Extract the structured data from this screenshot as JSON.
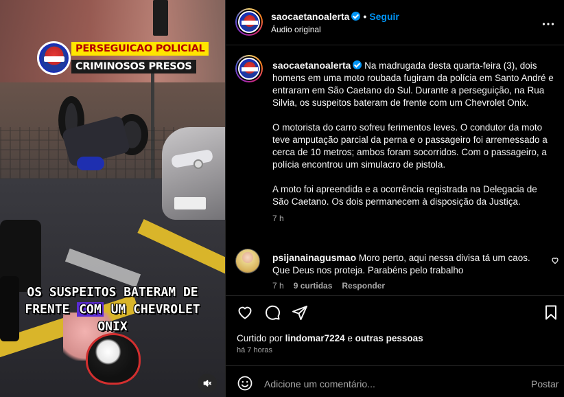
{
  "media": {
    "overlay_tag_1": "PERSEGUICAO POLICIAL",
    "overlay_tag_2": "CRIMINOSOS PRESOS",
    "caption_part1": "OS SUSPEITOS BATERAM DE",
    "caption_part2a": "FRENTE ",
    "caption_highlight": "COM",
    "caption_part2b": " UM CHEVROLET",
    "caption_part3": "ONIX",
    "logo_text": "SÃO CAETANO ALERTA",
    "mute_icon": "speaker-muted-icon",
    "colors": {
      "tag_yellow": "#ffe500",
      "tag_red_text": "#b30000",
      "highlight": "#5b2bd6"
    }
  },
  "header": {
    "username": "saocaetanoalerta",
    "separator": "•",
    "follow_label": "Seguir",
    "subtitle": "Áudio original",
    "more_icon": "more-horizontal-icon"
  },
  "post": {
    "username": "saocaetanoalerta",
    "paragraph1": "Na madrugada desta quarta-feira (3), dois homens em uma moto roubada fugiram da polícia em Santo André e entraram em São Caetano do Sul. Durante a perseguição, na Rua Silvia, os suspeitos bateram de frente com um Chevrolet Onix.",
    "paragraph2": "O motorista do carro sofreu ferimentos leves. O condutor da moto teve amputação parcial da perna e o passageiro foi arremessado a cerca de 10 metros; ambos foram socorridos. Com o passageiro, a polícia encontrou um simulacro de pistola.",
    "paragraph3": "A moto foi apreendida e a ocorrência registrada na Delegacia de São Caetano. Os dois permanecem à disposição da Justiça.",
    "time": "7 h"
  },
  "comment": {
    "username": "psijanainagusmao",
    "text": "Moro perto, aqui nessa divisa tá um caos. Que Deus nos proteja. Parabéns pelo trabalho",
    "time": "7 h",
    "likes": "9 curtidas",
    "reply_label": "Responder"
  },
  "actions": {
    "icons": [
      "heart-icon",
      "comment-icon",
      "share-icon",
      "bookmark-icon"
    ]
  },
  "likes": {
    "prefix": "Curtido por",
    "user": "lindomar7224",
    "connector": "e",
    "others": "outras pessoas"
  },
  "timestamp": "há 7 horas",
  "add_comment": {
    "placeholder": "Adicione um comentário...",
    "post_label": "Postar"
  },
  "colors": {
    "accent_blue": "#0095f6",
    "text_primary": "#f5f5f5",
    "text_secondary": "#a8a8a8",
    "background": "#000000"
  }
}
